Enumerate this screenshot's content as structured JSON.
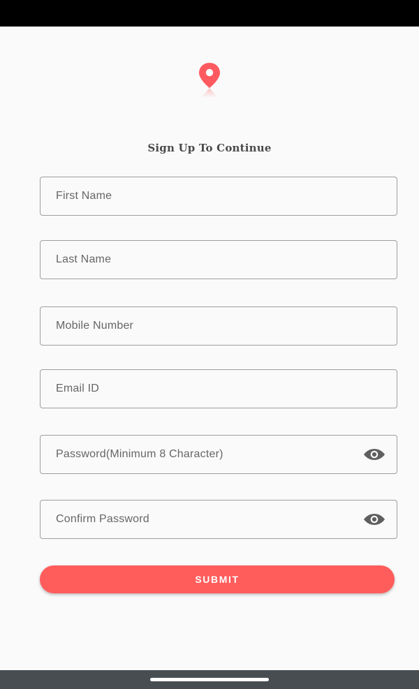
{
  "title": "Sign Up To Continue",
  "logo": {
    "icon": "map-pin-icon",
    "color": "#ff5a5f"
  },
  "fields": {
    "first_name": {
      "placeholder": "First Name",
      "value": ""
    },
    "last_name": {
      "placeholder": "Last Name",
      "value": ""
    },
    "mobile": {
      "placeholder": "Mobile Number",
      "value": ""
    },
    "email": {
      "placeholder": "Email ID",
      "value": ""
    },
    "password": {
      "placeholder": "Password(Minimum 8 Character)",
      "value": "",
      "toggle_icon": "eye-icon"
    },
    "confirm_password": {
      "placeholder": "Confirm Password",
      "value": "",
      "toggle_icon": "eye-icon"
    }
  },
  "submit_label": "SUBMIT",
  "colors": {
    "accent": "#ff5c5c",
    "border": "#9e9e9e",
    "placeholder": "#666666",
    "background": "#fafafa"
  }
}
